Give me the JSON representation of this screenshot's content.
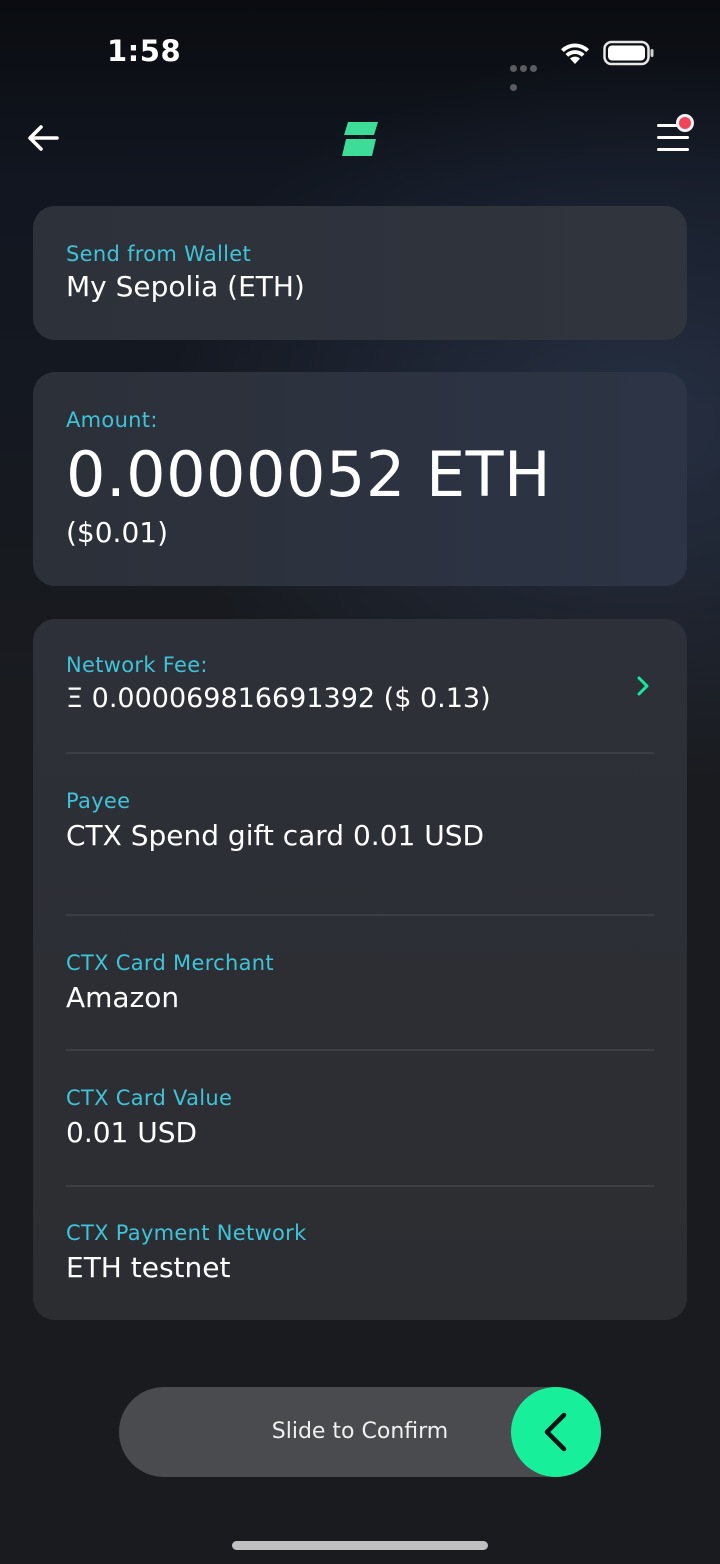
{
  "status_bar": {
    "time": "1:58"
  },
  "nav": {
    "back_icon": "arrow-left-icon",
    "logo_icon": "app-logo-icon",
    "menu_icon": "hamburger-menu-icon",
    "menu_badge_color": "#f0445a",
    "logo_color": "#3ddc97"
  },
  "wallet": {
    "label": "Send from Wallet",
    "value": "My Sepolia (ETH)"
  },
  "amount": {
    "label": "Amount:",
    "value": "0.0000052 ETH",
    "fiat": "($0.01)"
  },
  "details": {
    "network_fee": {
      "label": "Network Fee:",
      "value": "Ξ 0.000069816691392 ($ 0.13)"
    },
    "payee": {
      "label": "Payee",
      "value": "CTX Spend gift card 0.01 USD"
    },
    "merchant": {
      "label": "CTX Card Merchant",
      "value": "Amazon"
    },
    "card_value": {
      "label": "CTX Card Value",
      "value": "0.01 USD"
    },
    "payment_network": {
      "label": "CTX Payment Network",
      "value": "ETH testnet"
    }
  },
  "slider": {
    "label": "Slide to Confirm",
    "knob_color": "#18ef9b"
  },
  "colors": {
    "accent_label": "#3fc3d9",
    "background": "#1b1c1f"
  }
}
